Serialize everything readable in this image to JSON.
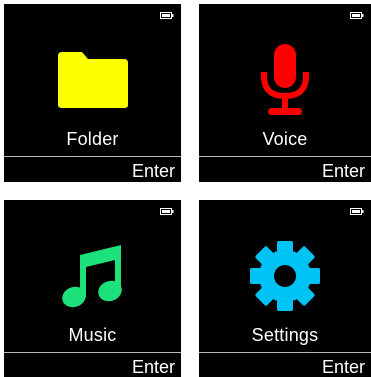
{
  "screens": [
    {
      "title": "Folder",
      "action": "Enter",
      "icon": "folder-icon",
      "icon_color": "#ffff00"
    },
    {
      "title": "Voice",
      "action": "Enter",
      "icon": "microphone-icon",
      "icon_color": "#ff0000"
    },
    {
      "title": "Music",
      "action": "Enter",
      "icon": "music-note-icon",
      "icon_color": "#1de27c"
    },
    {
      "title": "Settings",
      "action": "Enter",
      "icon": "gear-icon",
      "icon_color": "#00c3f5"
    }
  ],
  "colors": {
    "screen_bg": "#000000",
    "text": "#ffffff",
    "divider": "#b8b8b8"
  },
  "battery_icon": "battery-icon"
}
